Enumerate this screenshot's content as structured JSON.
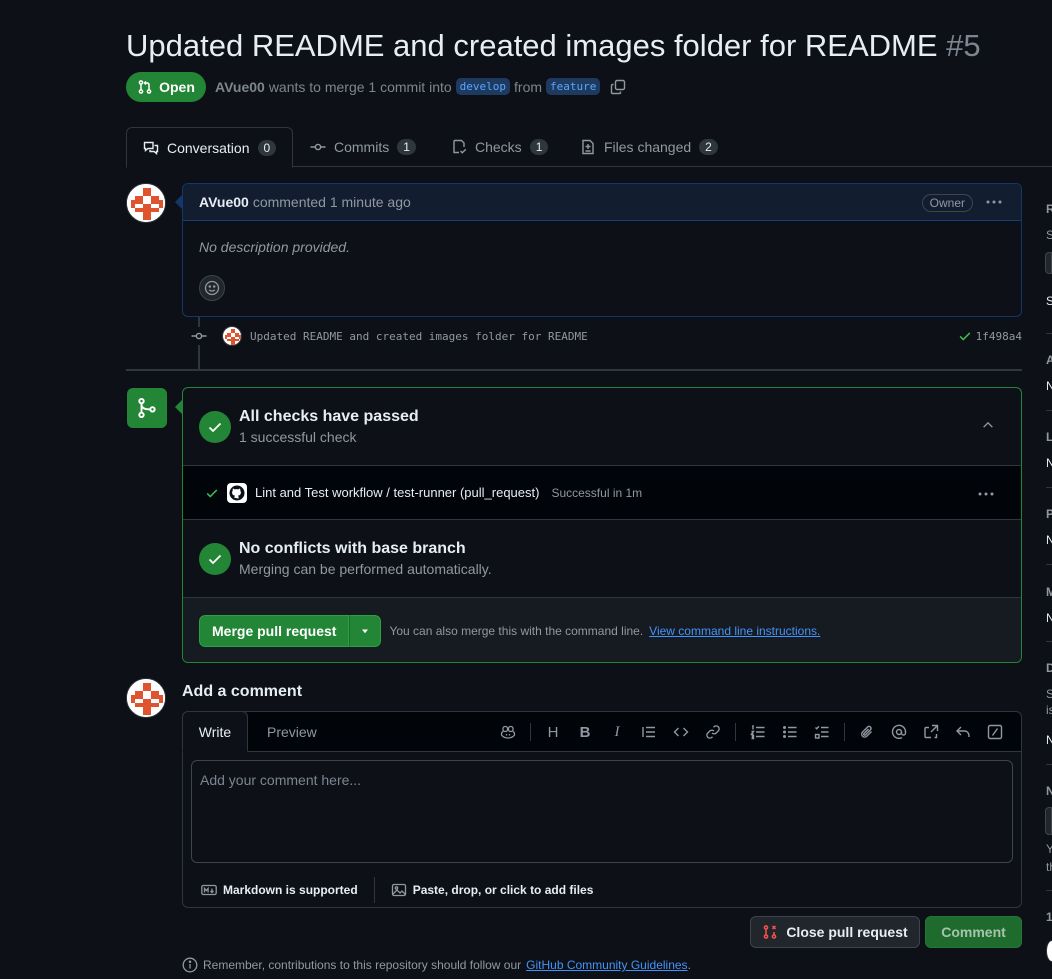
{
  "pr": {
    "title": "Updated README and created images folder for README",
    "number": "#5",
    "state": "Open",
    "author": "AVue00",
    "meta_middle": "wants to merge 1 commit into",
    "base_branch": "develop",
    "meta_from": "from",
    "head_branch": "feature"
  },
  "tabs": [
    {
      "label": "Conversation",
      "count": "0"
    },
    {
      "label": "Commits",
      "count": "1"
    },
    {
      "label": "Checks",
      "count": "1"
    },
    {
      "label": "Files changed",
      "count": "2"
    }
  ],
  "comment": {
    "author": "AVue00",
    "action": "commented 1 minute ago",
    "badge": "Owner",
    "body": "No description provided."
  },
  "commit": {
    "message": "Updated README and created images folder for README",
    "sha": "1f498a4"
  },
  "checks": {
    "title": "All checks have passed",
    "subtitle": "1 successful check",
    "row_name": "Lint and Test workflow / test-runner (pull_request)",
    "row_status": "Successful in 1m"
  },
  "conflicts": {
    "title": "No conflicts with base branch",
    "subtitle": "Merging can be performed automatically."
  },
  "merge": {
    "button": "Merge pull request",
    "hint": "You can also merge this with the command line.",
    "link": "View command line instructions."
  },
  "add_comment": {
    "title": "Add a comment",
    "tab_write": "Write",
    "tab_preview": "Preview",
    "toolbar_heading": "H",
    "toolbar_bold": "B",
    "toolbar_italic": "I",
    "placeholder": "Add your comment here...",
    "markdown": "Markdown is supported",
    "attach": "Paste, drop, or click to add files"
  },
  "actions": {
    "close": "Close pull request",
    "comment": "Comment"
  },
  "guidelines": {
    "text": "Remember, contributions to this repository should follow our",
    "link": "GitHub Community Guidelines",
    "end": "."
  },
  "sidebar": {
    "letters": [
      "R",
      "S",
      "S",
      "A",
      "N",
      "L",
      "N",
      "P",
      "N",
      "M",
      "N",
      "D",
      "S",
      "is",
      "N",
      "N",
      "Y",
      "th",
      "1"
    ]
  },
  "colors": {
    "accent_green": "#238636",
    "link_blue": "#4493f8",
    "background": "#0d1117"
  }
}
